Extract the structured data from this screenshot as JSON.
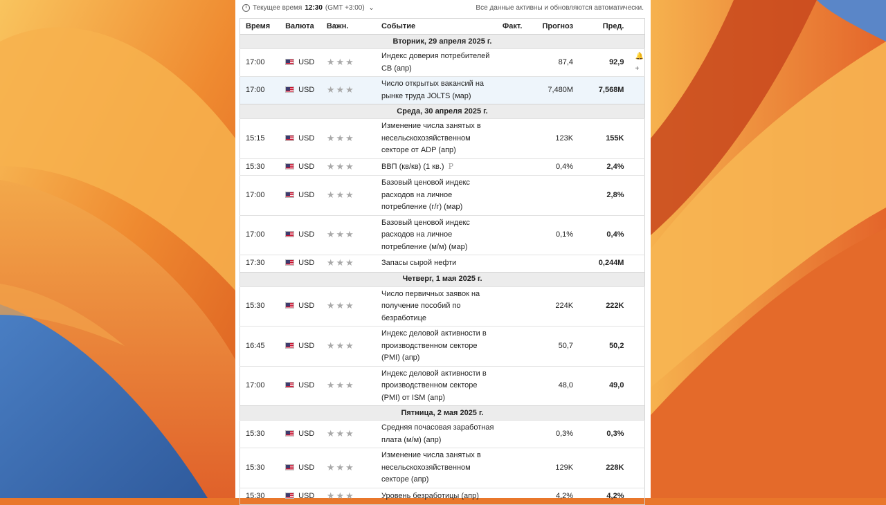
{
  "topbar": {
    "time_label": "Текущее время",
    "time_value": "12:30",
    "timezone": "(GMT +3:00)",
    "auto_update_note": "Все данные активны и обновляются автоматически."
  },
  "table": {
    "headers": {
      "time": "Время",
      "currency": "Валюта",
      "importance": "Важн.",
      "event": "Событие",
      "actual": "Факт.",
      "forecast": "Прогноз",
      "previous": "Пред."
    },
    "importance_stars": "★★★",
    "days": [
      {
        "label": "Вторник, 29 апреля 2025 г.",
        "events": [
          {
            "time": "17:00",
            "currency": "USD",
            "event": "Индекс доверия потребителей CB (апр)",
            "actual": "",
            "forecast": "87,4",
            "previous": "92,9",
            "alert": "🔔+"
          },
          {
            "time": "17:00",
            "currency": "USD",
            "event": "Число открытых вакансий на рынке труда JOLTS (мар)",
            "actual": "",
            "forecast": "7,480M",
            "previous": "7,568M"
          }
        ]
      },
      {
        "label": "Среда, 30 апреля 2025 г.",
        "events": [
          {
            "time": "15:15",
            "currency": "USD",
            "event": "Изменение числа занятых в несельскохозяйственном секторе от ADP (апр)",
            "actual": "",
            "forecast": "123K",
            "previous": "155K"
          },
          {
            "time": "15:30",
            "currency": "USD",
            "event": "ВВП (кв/кв) (1 кв.)",
            "mark": "P",
            "actual": "",
            "forecast": "0,4%",
            "previous": "2,4%"
          },
          {
            "time": "17:00",
            "currency": "USD",
            "event": "Базовый ценовой индекс расходов на личное потребление (г/г) (мар)",
            "actual": "",
            "forecast": "",
            "previous": "2,8%"
          },
          {
            "time": "17:00",
            "currency": "USD",
            "event": "Базовый ценовой индекс расходов на личное потребление (м/м) (мар)",
            "actual": "",
            "forecast": "0,1%",
            "previous": "0,4%"
          },
          {
            "time": "17:30",
            "currency": "USD",
            "event": "Запасы сырой нефти",
            "actual": "",
            "forecast": "",
            "previous": "0,244M"
          }
        ]
      },
      {
        "label": "Четверг, 1 мая 2025 г.",
        "events": [
          {
            "time": "15:30",
            "currency": "USD",
            "event": "Число первичных заявок на получение пособий по безработице",
            "actual": "",
            "forecast": "224K",
            "previous": "222K"
          },
          {
            "time": "16:45",
            "currency": "USD",
            "event": "Индекс деловой активности в производственном секторе (PMI) (апр)",
            "actual": "",
            "forecast": "50,7",
            "previous": "50,2"
          },
          {
            "time": "17:00",
            "currency": "USD",
            "event": "Индекс деловой активности в производственном секторе (PMI) от ISM (апр)",
            "actual": "",
            "forecast": "48,0",
            "previous": "49,0"
          }
        ]
      },
      {
        "label": "Пятница, 2 мая 2025 г.",
        "events": [
          {
            "time": "15:30",
            "currency": "USD",
            "event": "Средняя почасовая заработная плата (м/м) (апр)",
            "actual": "",
            "forecast": "0,3%",
            "previous": "0,3%"
          },
          {
            "time": "15:30",
            "currency": "USD",
            "event": "Изменение числа занятых в несельскохозяйственном секторе (апр)",
            "actual": "",
            "forecast": "129K",
            "previous": "228K"
          },
          {
            "time": "15:30",
            "currency": "USD",
            "event": "Уровень безработицы (апр)",
            "actual": "",
            "forecast": "4,2%",
            "previous": "4,2%"
          }
        ]
      }
    ]
  },
  "colors": {
    "wallpaper_orange": "#e9772b",
    "wallpaper_yellow": "#f6b44a",
    "wallpaper_blue": "#3d6fb5",
    "day_header_bg": "#ececec",
    "highlight_row_bg": "#eef5fb",
    "star_grey": "#a9a9a9"
  }
}
